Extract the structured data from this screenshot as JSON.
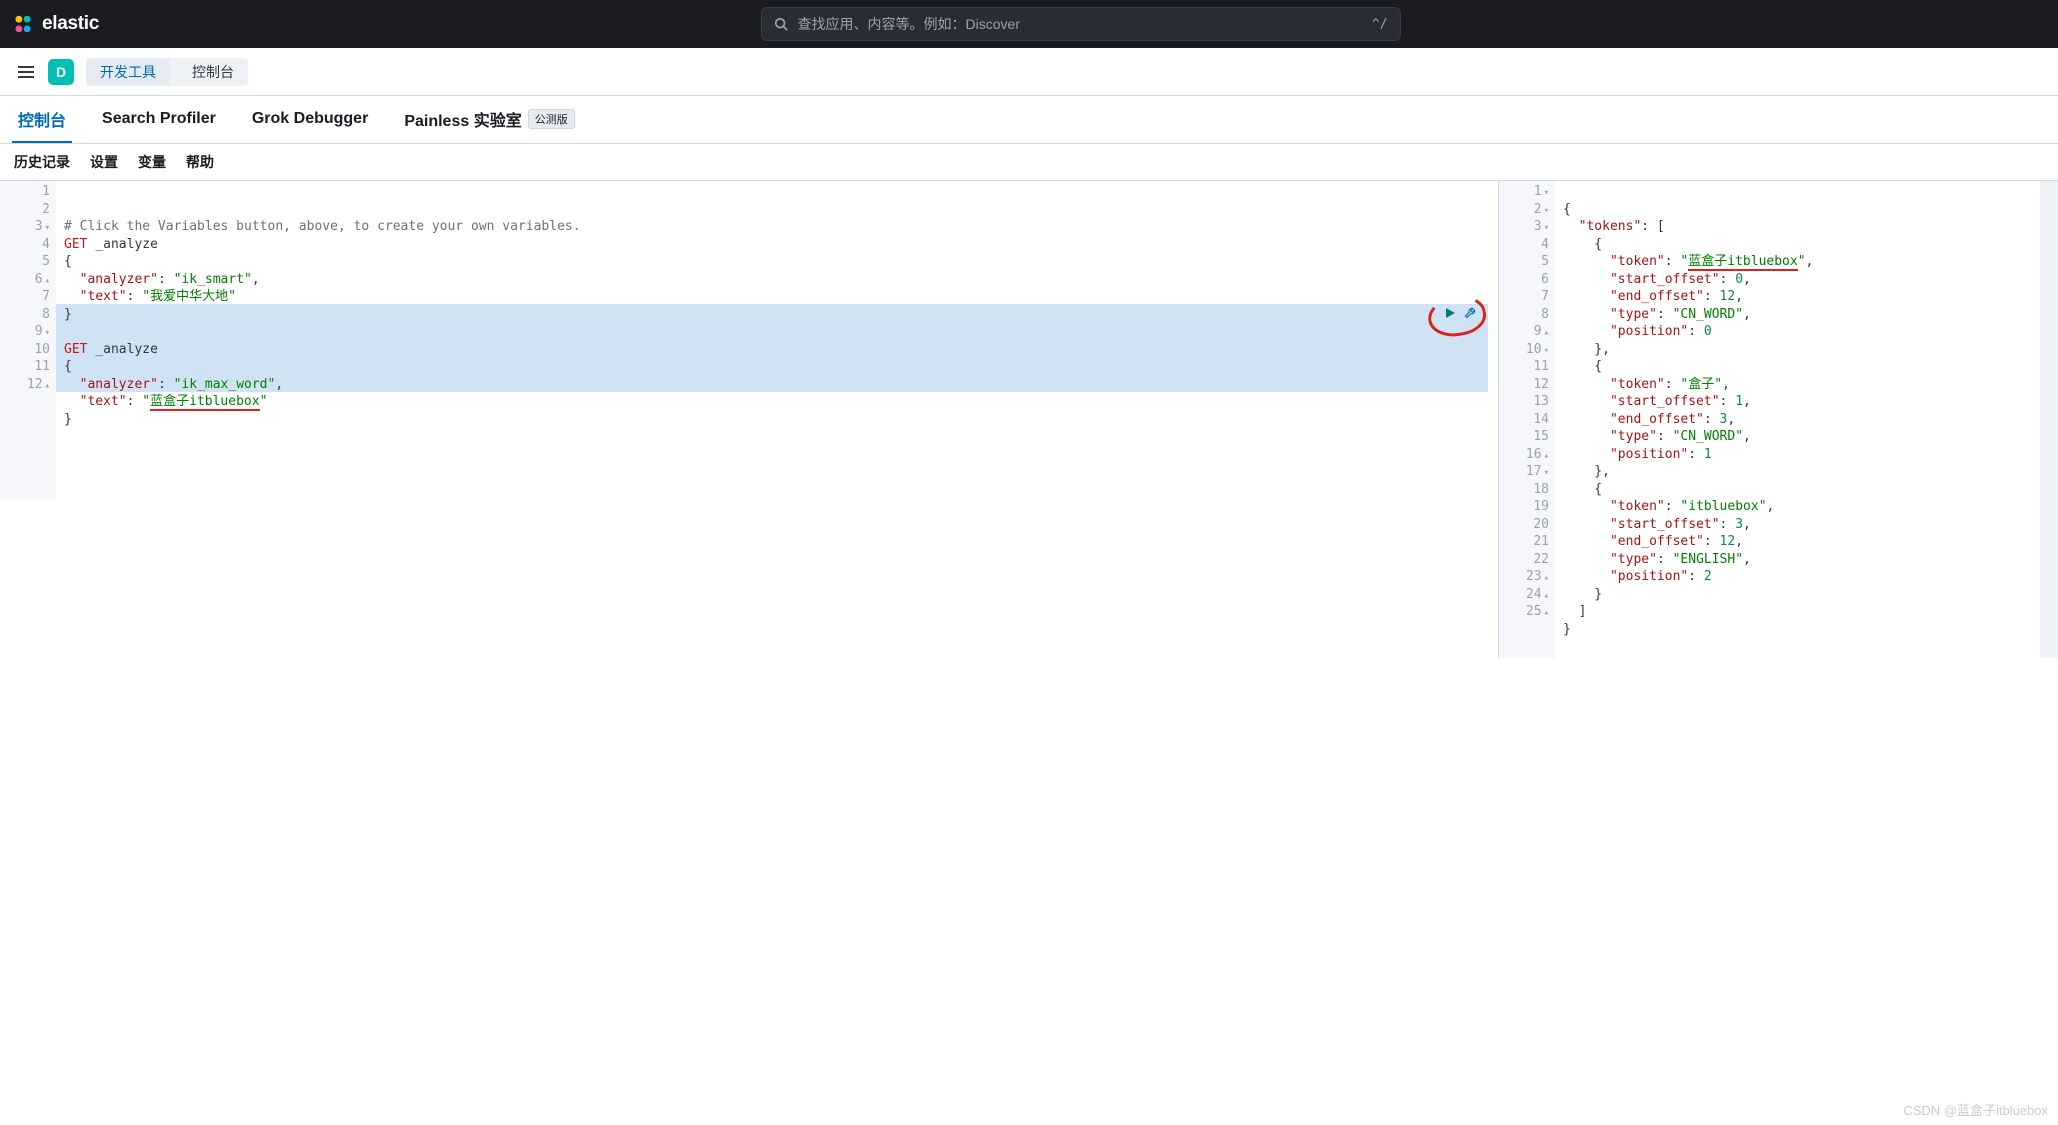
{
  "header": {
    "brand": "elastic",
    "search_placeholder": "查找应用、内容等。例如：Discover",
    "shortcut_hint": "^/"
  },
  "subheader": {
    "space_letter": "D",
    "crumb1": "开发工具",
    "crumb2": "控制台"
  },
  "tabs": {
    "console": "控制台",
    "profiler": "Search Profiler",
    "grok": "Grok Debugger",
    "painless": "Painless 实验室",
    "beta": "公测版"
  },
  "toolbar": {
    "history": "历史记录",
    "settings": "设置",
    "variables": "变量",
    "help": "帮助"
  },
  "editor_left": {
    "gutter": [
      "1",
      "2",
      "3",
      "4",
      "5",
      "6",
      "7",
      "8",
      "9",
      "10",
      "11",
      "12"
    ],
    "folds": {
      "3": "▾",
      "6": "▴",
      "9": "▾",
      "12": "▴"
    },
    "comment": "# Click the Variables button, above, to create your own variables.",
    "req1": {
      "method": "GET",
      "path": "_analyze",
      "k_analyzer": "\"analyzer\"",
      "v_analyzer": "\"ik_smart\"",
      "k_text": "\"text\"",
      "v_text": "\"我爱中华大地\""
    },
    "req2": {
      "method": "GET",
      "path": "_analyze",
      "k_analyzer": "\"analyzer\"",
      "v_analyzer": "\"ik_max_word\"",
      "k_text": "\"text\"",
      "v_text_pre": "\"",
      "v_text_cn": "蓝盒子",
      "v_text_en": "itbluebox",
      "v_text_suf": "\""
    }
  },
  "editor_right": {
    "gutter": [
      "1",
      "2",
      "3",
      "4",
      "5",
      "6",
      "7",
      "8",
      "9",
      "10",
      "11",
      "12",
      "13",
      "14",
      "15",
      "16",
      "17",
      "18",
      "19",
      "20",
      "21",
      "22",
      "23",
      "24",
      "25"
    ],
    "folds": {
      "1": "▾",
      "2": "▾",
      "3": "▾",
      "9": "▴",
      "10": "▾",
      "16": "▴",
      "17": "▾",
      "23": "▴",
      "24": "▴",
      "25": "▴"
    },
    "k_tokens": "\"tokens\"",
    "k_token": "\"token\"",
    "k_start": "\"start_offset\"",
    "k_end": "\"end_offset\"",
    "k_type": "\"type\"",
    "k_pos": "\"position\"",
    "t1": {
      "token_cn": "蓝盒子",
      "token_en": "itbluebox",
      "start": "0",
      "end": "12",
      "type": "\"CN_WORD\"",
      "pos": "0"
    },
    "t2": {
      "token": "\"盒子\"",
      "start": "1",
      "end": "3",
      "type": "\"CN_WORD\"",
      "pos": "1"
    },
    "t3": {
      "token": "\"itbluebox\"",
      "start": "3",
      "end": "12",
      "type": "\"ENGLISH\"",
      "pos": "2"
    }
  },
  "watermark": "CSDN @蓝盒子itbluebox"
}
